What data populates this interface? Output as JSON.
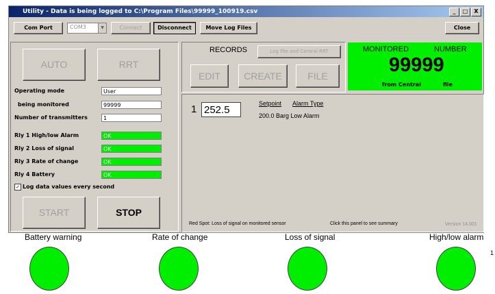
{
  "window": {
    "title": "Utility - Data is being logged to C:\\Program Files\\99999_100919.csv",
    "controls": [
      "_",
      "□",
      "X"
    ]
  },
  "toolbar": {
    "com_port": "Com Port",
    "com_port_value": "COM3",
    "connect": "Connect",
    "disconnect": "Disconnect",
    "move_log_files": "Move Log Files",
    "close": "Close"
  },
  "left": {
    "auto": "AUTO",
    "rrt": "RRT",
    "fields": [
      {
        "label": "Operating mode",
        "value": "User"
      },
      {
        "label": "being monitored",
        "value": "99999"
      },
      {
        "label": "Number of transmitters",
        "value": "1"
      }
    ],
    "relays": [
      {
        "label": "Rly 1 High/low Alarm",
        "value": "OK"
      },
      {
        "label": "Rly 2 Loss of signal",
        "value": "OK"
      },
      {
        "label": "Rly 3 Rate of change",
        "value": "OK"
      },
      {
        "label": "Rly 4 Battery",
        "value": "OK"
      }
    ],
    "log_checkbox": "Log data values every second",
    "start": "START",
    "stop": "STOP"
  },
  "records": {
    "title": "RECORDS",
    "log_file_button": "Log File and Central RRT",
    "edit": "EDIT",
    "create": "CREATE",
    "file": "FILE"
  },
  "monitored": {
    "label_left": "MONITORED",
    "label_right": "NUMBER",
    "number": "99999",
    "sub_left": "from Central",
    "sub_right": "file",
    "bg_color": "#00ee00"
  },
  "summary": {
    "index": "1",
    "value": "252.5",
    "col_setpoint": "Setpoint",
    "col_alarm_type": "Alarm Type",
    "row": "200.0 Barg Low Alarm",
    "status_text": "Red Spot: Loss of signal on monitored sensor",
    "hint": "Click this panel to see summary",
    "version": "Version 14.001"
  },
  "indicators": [
    {
      "label": "Battery warning",
      "color": "#00ee00"
    },
    {
      "label": "Rate of change",
      "color": "#00ee00"
    },
    {
      "label": "Loss of signal",
      "color": "#00ee00"
    },
    {
      "label": "High/low alarm",
      "color": "#00ee00"
    }
  ],
  "edge_mark": "1"
}
